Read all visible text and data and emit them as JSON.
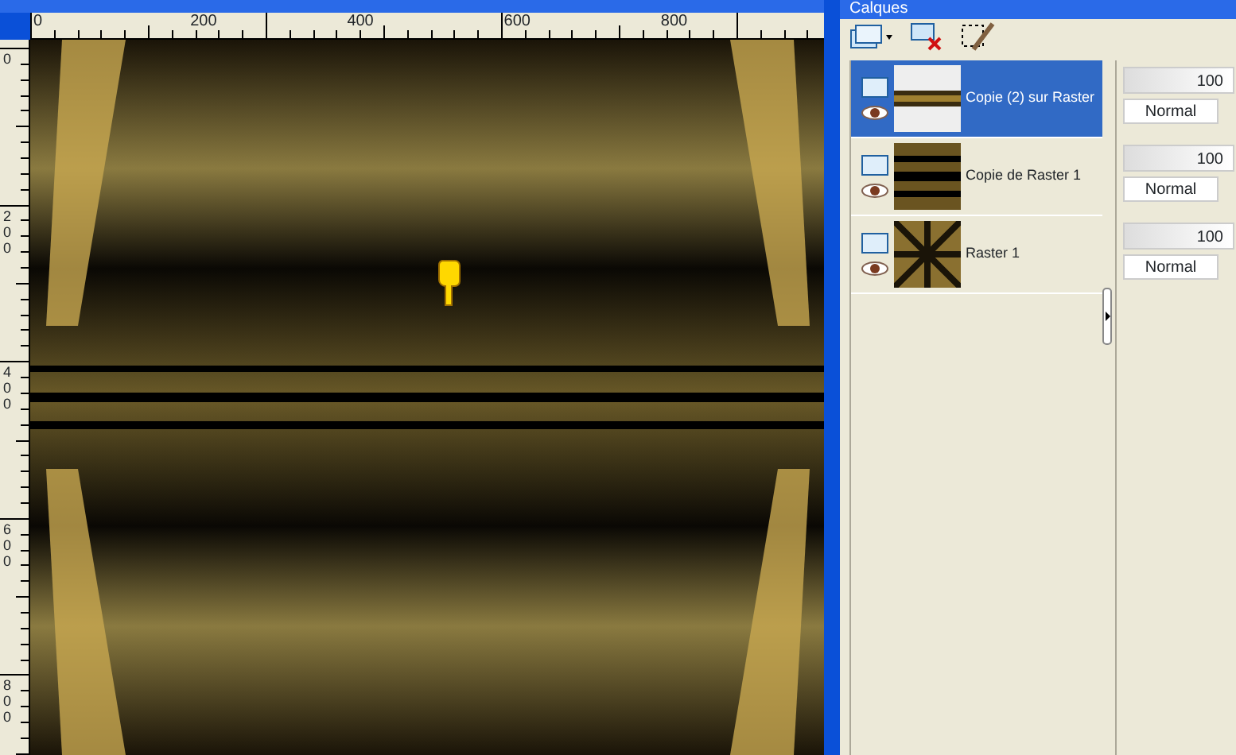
{
  "canvas_window": {
    "ruler_h": [
      "0",
      "200",
      "400",
      "600",
      "800"
    ],
    "ruler_v": [
      "0",
      "200",
      "400",
      "600",
      "800"
    ]
  },
  "layers_palette": {
    "title": "Calques",
    "layers": [
      {
        "name": "Copie (2) sur Raster",
        "selected": true,
        "visible": true,
        "kind": "strip",
        "opacity": "100",
        "level": 1,
        "blend": "Normal"
      },
      {
        "name": "Copie de Raster 1",
        "selected": false,
        "visible": true,
        "kind": "bands",
        "opacity": "100",
        "level": 1,
        "blend": "Normal"
      },
      {
        "name": "Raster 1",
        "selected": false,
        "visible": true,
        "kind": "radial",
        "opacity": "100",
        "level": 1,
        "blend": "Normal"
      }
    ]
  }
}
